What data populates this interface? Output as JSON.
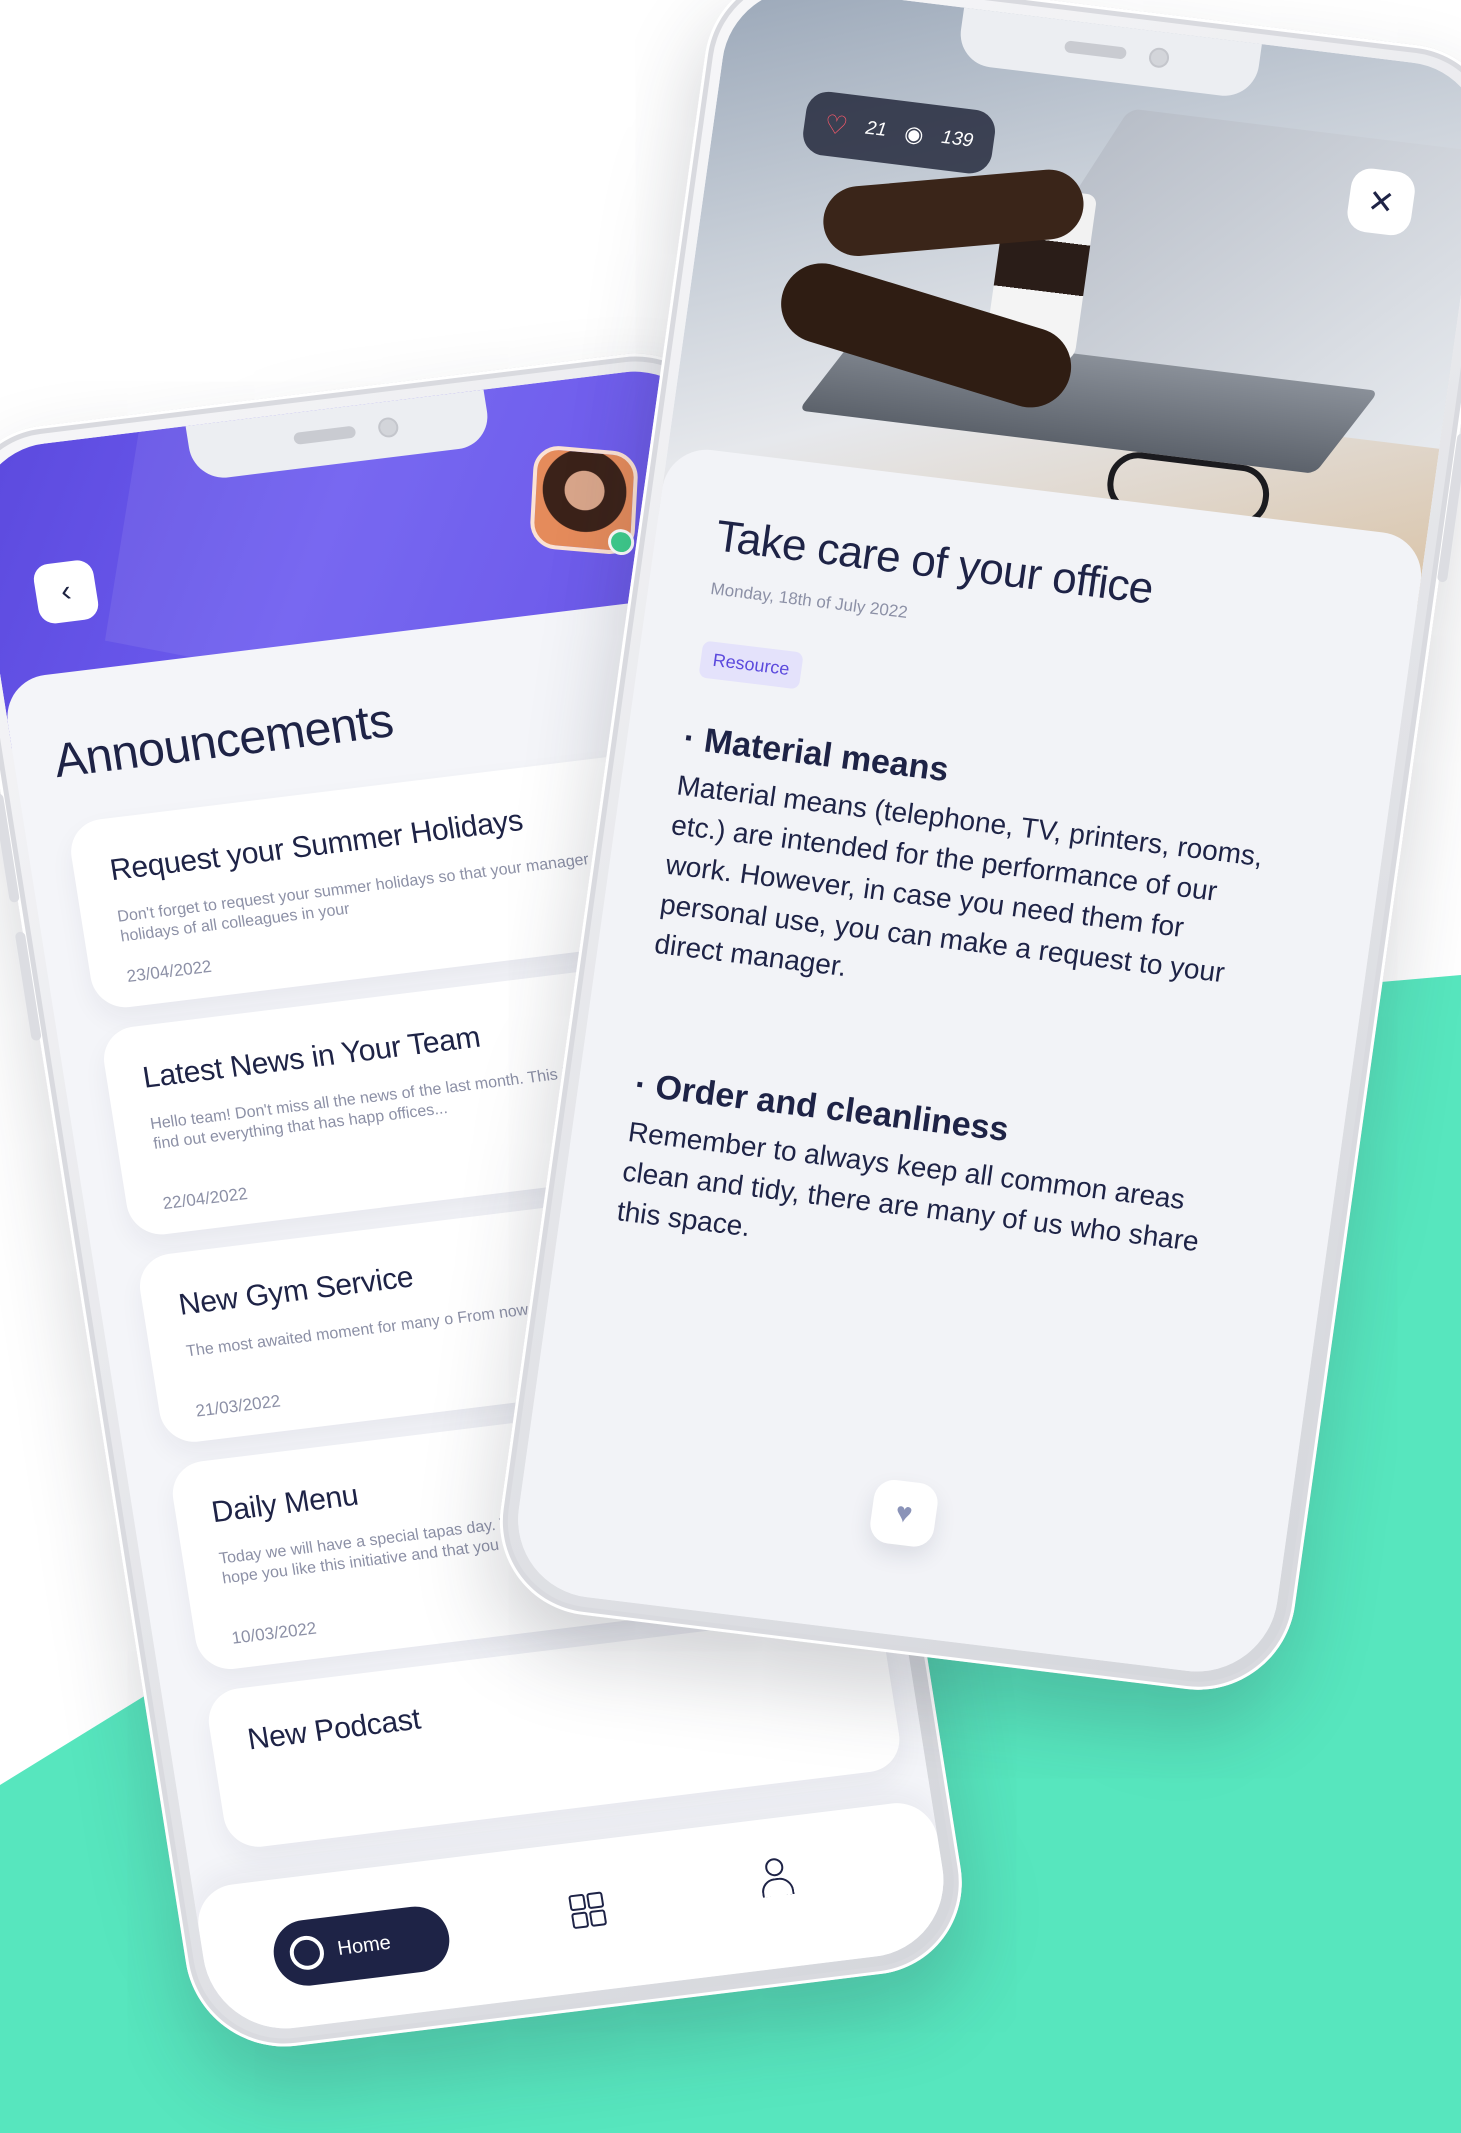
{
  "colors": {
    "accent_green": "#57e6be",
    "header_purple": "#5b49dd",
    "navy": "#1e2346",
    "muted_text": "#8c90a6",
    "badge_bg": "#e4e2fb"
  },
  "left_phone": {
    "back_icon": "chevron-left-icon",
    "back_glyph": "‹",
    "page_title": "Announcements",
    "announcements": [
      {
        "title": "Request your Summer Holidays",
        "excerpt": "Don't forget to request your summer holidays so that your manager can manage the holidays of all colleagues in your",
        "date": "23/04/2022"
      },
      {
        "title": "Latest News in Your Team",
        "excerpt": "Hello team! Don't miss all the news of the last month. This May we stopped working, find out everything that has happ offices...",
        "date": "22/04/2022"
      },
      {
        "title": "New Gym Service",
        "excerpt": "The most awaited moment for many o From now on we can use the gym for f",
        "date": "21/03/2022"
      },
      {
        "title": "Daily Menu",
        "excerpt": "Today we will have a special tapas day. The regular Daily menu will be cancelled. We hope you like this initiative and that you enjoy it.",
        "date": "10/03/2022"
      },
      {
        "title": "New Podcast",
        "excerpt": "",
        "date": ""
      }
    ],
    "tabbar": {
      "home_label": "Home",
      "home_icon": "home-hexagon-icon",
      "grid_icon": "grid-icon",
      "profile_icon": "user-icon"
    }
  },
  "right_phone": {
    "likes": "21",
    "views": "139",
    "heart_icon": "heart-outline-icon",
    "heart_glyph": "♡",
    "eye_icon": "eye-icon",
    "eye_glyph": "◉",
    "close_icon": "close-icon",
    "close_glyph": "✕",
    "article_title": "Take care of your office",
    "article_date": "Monday, 18th of July 2022",
    "badge": "Resource",
    "sections": [
      {
        "heading": "· Material means",
        "body": "Material means (telephone, TV, printers, rooms, etc.) are intended for the performance of our work. However, in case you need them for personal use, you can make a request to your direct manager."
      },
      {
        "heading": "· Order and cleanliness",
        "body": "Remember to always keep all common areas clean and tidy, there are many of us who share this space."
      }
    ],
    "like_icon": "heart-filled-icon",
    "like_glyph": "♥"
  }
}
